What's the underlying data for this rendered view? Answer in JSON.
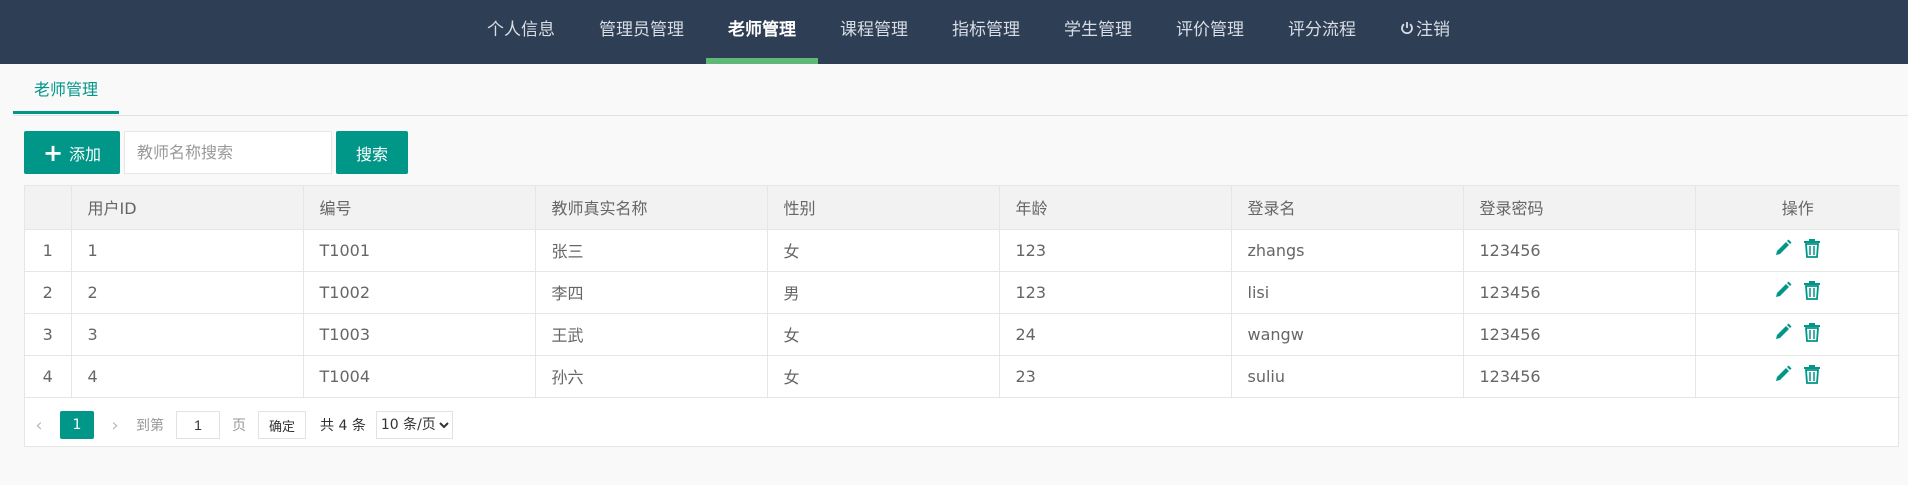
{
  "nav": {
    "items": [
      {
        "label": "个人信息"
      },
      {
        "label": "管理员管理"
      },
      {
        "label": "老师管理"
      },
      {
        "label": "课程管理"
      },
      {
        "label": "指标管理"
      },
      {
        "label": "学生管理"
      },
      {
        "label": "评价管理"
      },
      {
        "label": "评分流程"
      },
      {
        "label": "注销"
      }
    ],
    "active_index": 2,
    "active_color": "#5fb878"
  },
  "tab": {
    "label": "老师管理"
  },
  "toolbar": {
    "add_label": "添加",
    "search_placeholder": "教师名称搜索",
    "search_value": "",
    "search_label": "搜索"
  },
  "table": {
    "headers": [
      "用户ID",
      "编号",
      "教师真实名称",
      "性别",
      "年龄",
      "登录名",
      "登录密码",
      "操作"
    ],
    "rows": [
      {
        "index": "1",
        "id": "1",
        "code": "T1001",
        "name": "张三",
        "gender": "女",
        "age": "123",
        "login": "zhangs",
        "password": "123456"
      },
      {
        "index": "2",
        "id": "2",
        "code": "T1002",
        "name": "李四",
        "gender": "男",
        "age": "123",
        "login": "lisi",
        "password": "123456"
      },
      {
        "index": "3",
        "id": "3",
        "code": "T1003",
        "name": "王武",
        "gender": "女",
        "age": "24",
        "login": "wangw",
        "password": "123456"
      },
      {
        "index": "4",
        "id": "4",
        "code": "T1004",
        "name": "孙六",
        "gender": "女",
        "age": "23",
        "login": "suliu",
        "password": "123456"
      }
    ]
  },
  "pager": {
    "current": "1",
    "goto_label": "到第",
    "page_input": "1",
    "page_unit": "页",
    "confirm_label": "确定",
    "total": "共 4 条",
    "page_size": "10 条/页"
  },
  "theme": {
    "primary": "#009688",
    "header_bg": "#2e3e55"
  }
}
